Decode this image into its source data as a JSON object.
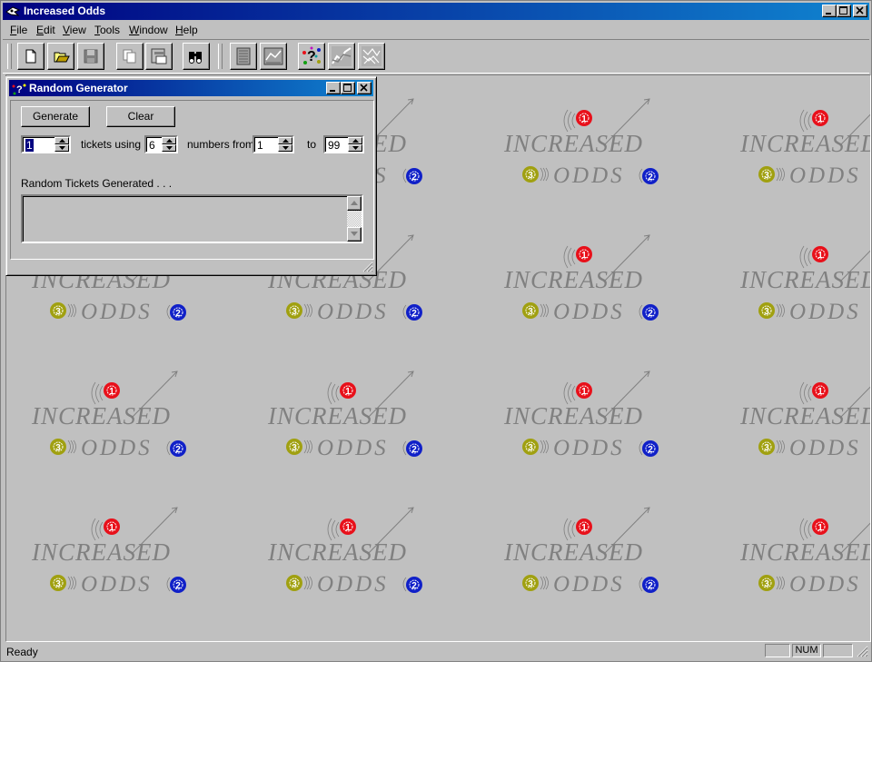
{
  "app": {
    "title": "Increased Odds",
    "menu": [
      {
        "label": "File",
        "key": "F",
        "rest": "ile"
      },
      {
        "label": "Edit",
        "key": "E",
        "rest": "dit"
      },
      {
        "label": "View",
        "key": "V",
        "rest": "iew"
      },
      {
        "label": "Tools",
        "key": "T",
        "rest": "ools"
      },
      {
        "label": "Window",
        "key": "W",
        "rest": "indow"
      },
      {
        "label": "Help",
        "key": "H",
        "rest": "elp"
      }
    ],
    "toolbar_icons": [
      "new-file-icon",
      "open-folder-icon",
      "save-icon",
      "copy-icon",
      "print-preview-icon",
      "find-icon",
      "report-icon",
      "chart-icon",
      "random-generator-icon",
      "trend-icon",
      "matrix-icon"
    ],
    "status": {
      "text": "Ready",
      "num": "NUM"
    },
    "wallpaper": {
      "line1": "INCREASED",
      "line2": "ODDS",
      "balls": [
        "1",
        "2",
        "3"
      ],
      "colors": {
        "ball1": "#e8101a",
        "ball2": "#1020c8",
        "ball3": "#a0a010",
        "text": "#808080"
      }
    }
  },
  "child": {
    "title": "Random Generator",
    "generate_label": "Generate",
    "clear_label": "Clear",
    "tickets": "1",
    "tickets_label": "tickets using",
    "numbers": "6",
    "numbers_label": "numbers from",
    "from": "1",
    "to_label": "to",
    "to": "99",
    "output_label": "Random Tickets Generated . . ."
  },
  "colors": {
    "titlebar_start": "#000080",
    "titlebar_end": "#1084d0",
    "face": "#c0c0c0"
  }
}
